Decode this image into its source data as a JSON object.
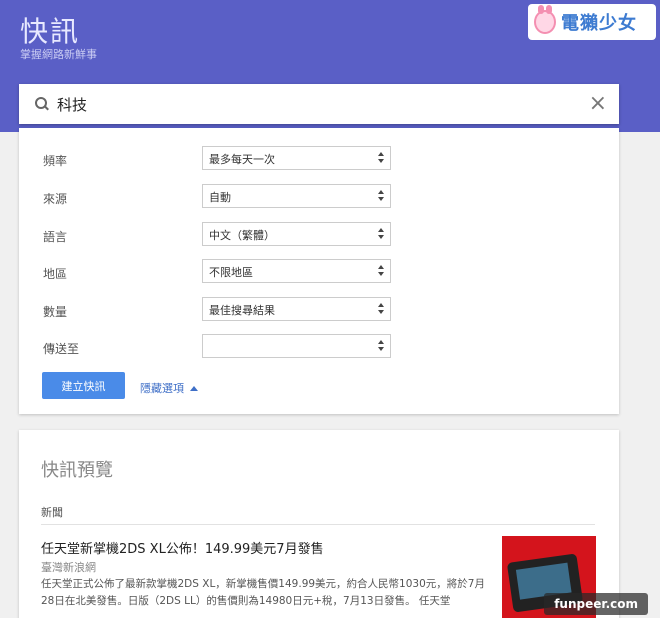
{
  "header": {
    "title": "快訊",
    "subtitle": "掌握網路新鮮事",
    "brand": "電獺少女"
  },
  "search": {
    "value": "科技"
  },
  "options": {
    "rows": [
      {
        "label": "頻率",
        "value": "最多每天一次"
      },
      {
        "label": "來源",
        "value": "自動"
      },
      {
        "label": "語言",
        "value": "中文（繁體）"
      },
      {
        "label": "地區",
        "value": "不限地區"
      },
      {
        "label": "數量",
        "value": "最佳搜尋結果"
      },
      {
        "label": "傳送至",
        "value": ""
      }
    ],
    "create_button": "建立快訊",
    "hide_options": "隱藏選項"
  },
  "preview": {
    "title": "快訊預覽",
    "section": "新聞",
    "article": {
      "title": "任天堂新掌機2DS XL公佈！149.99美元7月發售",
      "source": "臺灣新浪網",
      "snippet": "任天堂正式公佈了最新款掌機2DS XL，新掌機售價149.99美元，約合人民幣1030元，將於7月28日在北美發售。日版（2DS LL）的售價則為14980日元+稅，7月13日發售。 任天堂"
    }
  },
  "watermark": "funpeer.com"
}
